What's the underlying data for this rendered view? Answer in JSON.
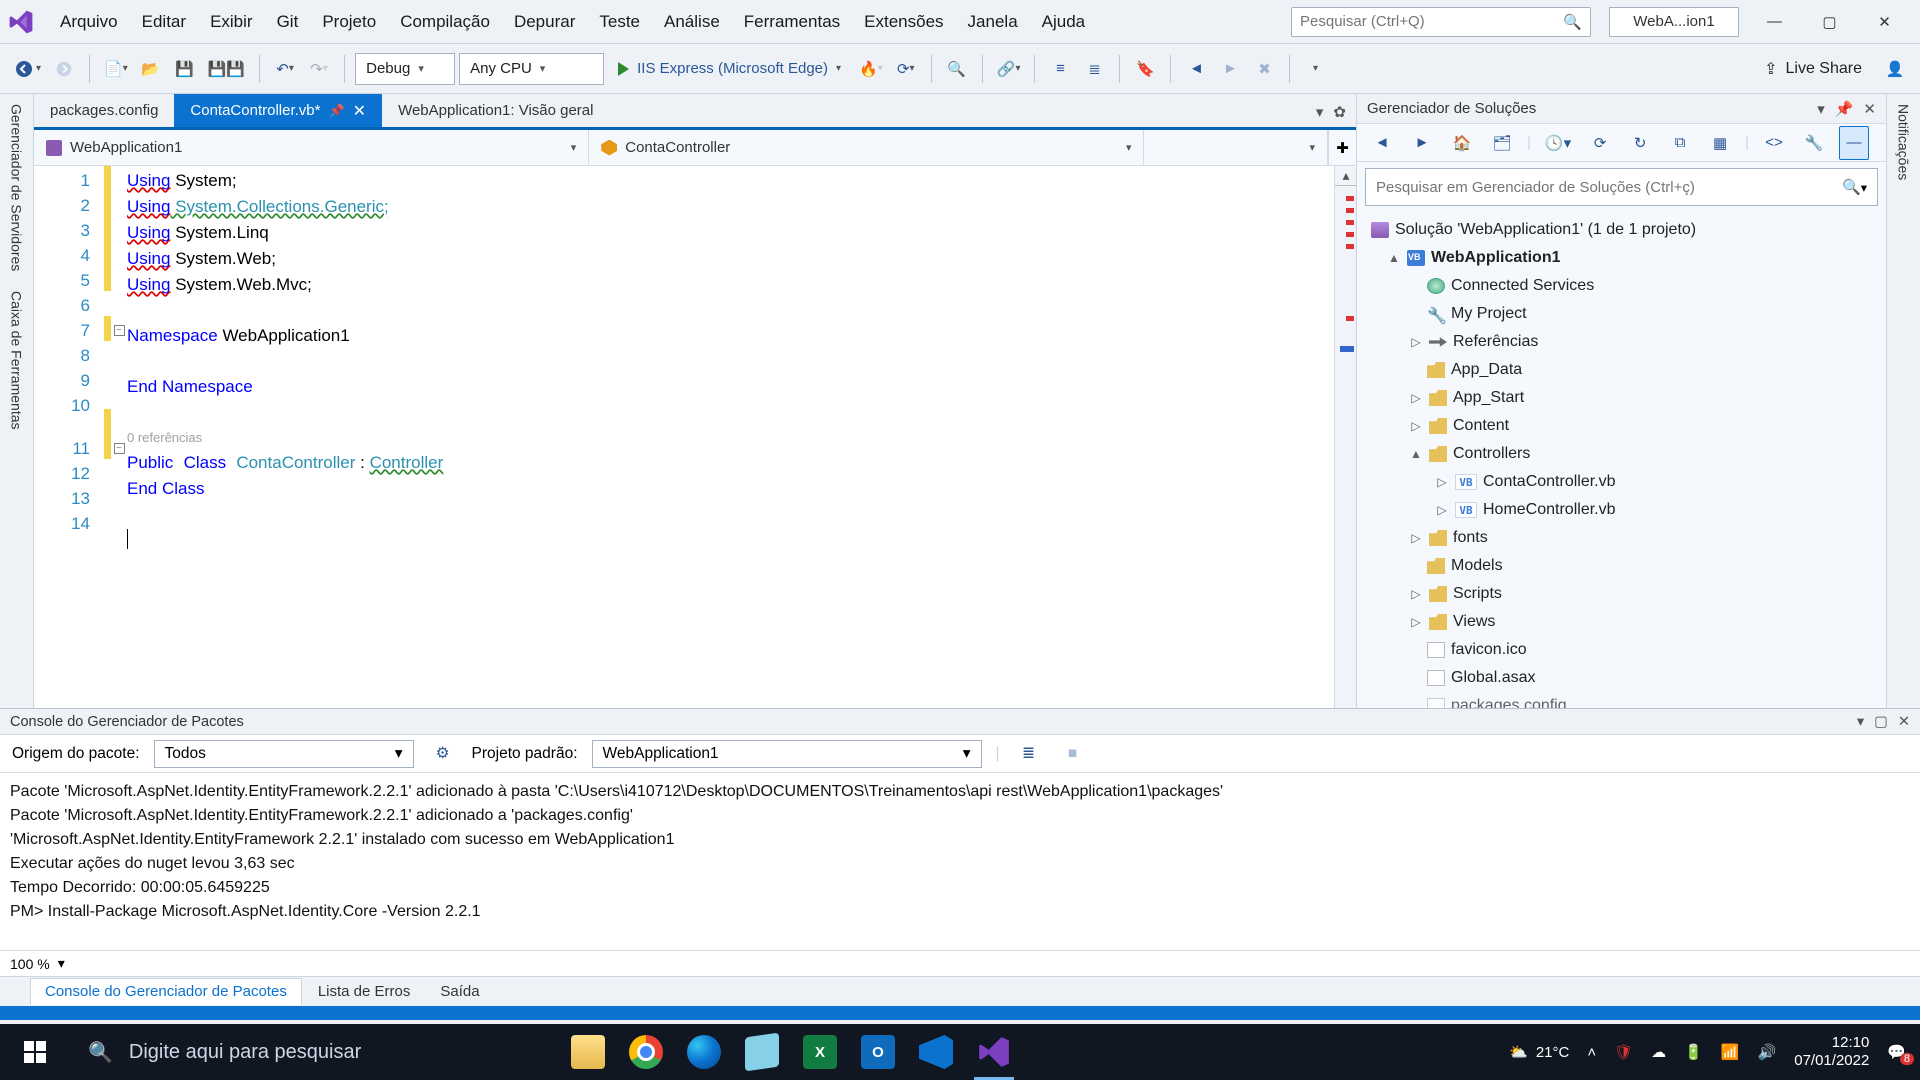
{
  "menubar": {
    "items": [
      "Arquivo",
      "Editar",
      "Exibir",
      "Git",
      "Projeto",
      "Compilação",
      "Depurar",
      "Teste",
      "Análise",
      "Ferramentas",
      "Extensões",
      "Janela",
      "Ajuda"
    ],
    "search_placeholder": "Pesquisar (Ctrl+Q)",
    "project_short": "WebA...ion1"
  },
  "toolbar": {
    "config": "Debug",
    "platform": "Any CPU",
    "run": "IIS Express (Microsoft Edge)",
    "live_share": "Live Share"
  },
  "left_rail": [
    "Gerenciador de Servidores",
    "Caixa de Ferramentas"
  ],
  "right_rail": [
    "Notificações"
  ],
  "tabs": [
    {
      "label": "packages.config",
      "active": false,
      "dirty": false
    },
    {
      "label": "ContaController.vb*",
      "active": true,
      "dirty": true
    },
    {
      "label": "WebApplication1: Visão geral",
      "active": false,
      "dirty": false
    }
  ],
  "nav": {
    "scope": "WebApplication1",
    "class": "ContaController",
    "member": ""
  },
  "code": {
    "lines": [
      "1",
      "2",
      "3",
      "4",
      "5",
      "6",
      "7",
      "8",
      "9",
      "10",
      "11",
      "12",
      "13",
      "14"
    ],
    "codelens": "0 referências",
    "l1a": "Using",
    "l1b": " System;",
    "l2a": "Using",
    "l2b": " System.Collections.Generic;",
    "l3a": "Using",
    "l3b": " System.Linq",
    "l4a": "Using",
    "l4b": " System.Web;",
    "l5a": "Using",
    "l5b": " System.Web.Mvc;",
    "l7a": "Namespace",
    "l7b": " WebApplication1",
    "l9": "End Namespace",
    "l11a": "Public",
    "l11b": "Class",
    "l11c": "ContaController",
    "l11d": " : ",
    "l11e": "Controller",
    "l12": "End Class"
  },
  "solexp": {
    "title": "Gerenciador de Soluções",
    "search_placeholder": "Pesquisar em Gerenciador de Soluções (Ctrl+ç)",
    "solution": "Solução 'WebApplication1' (1 de 1 projeto)",
    "project": "WebApplication1",
    "nodes": {
      "connected": "Connected Services",
      "myproject": "My Project",
      "references": "Referências",
      "appdata": "App_Data",
      "appstart": "App_Start",
      "content": "Content",
      "controllers": "Controllers",
      "conta": "ContaController.vb",
      "home": "HomeController.vb",
      "fonts": "fonts",
      "models": "Models",
      "scripts": "Scripts",
      "views": "Views",
      "favicon": "favicon.ico",
      "global": "Global.asax",
      "packages": "packages.config"
    }
  },
  "pmc": {
    "title": "Console do Gerenciador de Pacotes",
    "origin_label": "Origem do pacote:",
    "origin_value": "Todos",
    "project_label": "Projeto padrão:",
    "project_value": "WebApplication1",
    "lines": [
      "Pacote 'Microsoft.AspNet.Identity.EntityFramework.2.2.1' adicionado à pasta 'C:\\Users\\i410712\\Desktop\\DOCUMENTOS\\Treinamentos\\api rest\\WebApplication1\\packages'",
      "Pacote 'Microsoft.AspNet.Identity.EntityFramework.2.2.1' adicionado a 'packages.config'",
      "'Microsoft.AspNet.Identity.EntityFramework 2.2.1' instalado com sucesso em WebApplication1",
      "Executar ações do nuget levou 3,63 sec",
      "Tempo Decorrido: 00:00:05.6459225",
      "PM> Install-Package Microsoft.AspNet.Identity.Core -Version 2.2.1"
    ],
    "zoom": "100 %"
  },
  "tooltabs": {
    "active": "Console do Gerenciador de Pacotes",
    "t2": "Lista de Erros",
    "t3": "Saída"
  },
  "taskbar": {
    "search_placeholder": "Digite aqui para pesquisar",
    "temp": "21°C",
    "time": "12:10",
    "date": "07/01/2022",
    "notif_badge": "8"
  }
}
